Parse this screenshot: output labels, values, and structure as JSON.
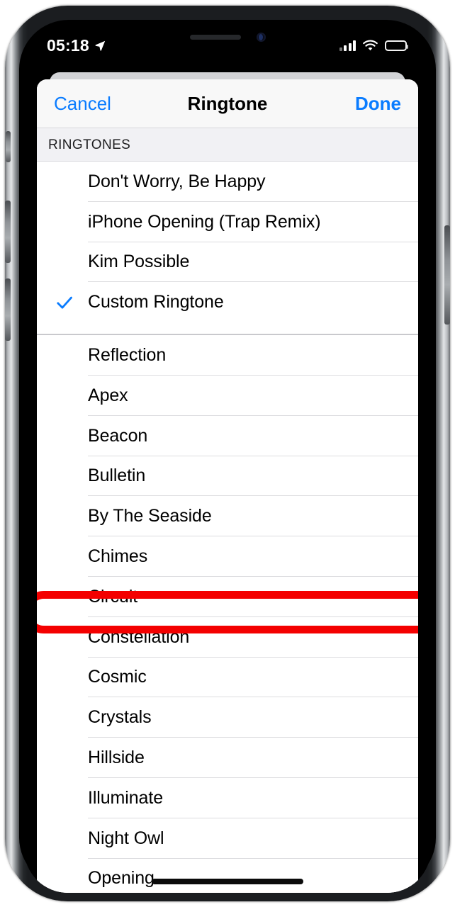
{
  "status_bar": {
    "time": "05:18",
    "location_icon": "location-arrow-icon",
    "signal_icon": "cellular-signal-icon",
    "wifi_icon": "wifi-icon",
    "battery_icon": "battery-full-icon"
  },
  "nav": {
    "cancel_label": "Cancel",
    "title": "Ringtone",
    "done_label": "Done"
  },
  "colors": {
    "accent_blue": "#0a7cff",
    "annotation_red": "#f40000",
    "header_bg": "#f1f1f4"
  },
  "sections": [
    {
      "header": "RINGTONES",
      "items": [
        {
          "label": "Don't Worry, Be Happy",
          "selected": false,
          "highlighted": false
        },
        {
          "label": "iPhone Opening (Trap Remix)",
          "selected": false,
          "highlighted": false
        },
        {
          "label": "Kim Possible",
          "selected": false,
          "highlighted": false
        },
        {
          "label": "Custom Ringtone",
          "selected": true,
          "highlighted": false
        }
      ]
    },
    {
      "header": "",
      "items": [
        {
          "label": "Reflection",
          "selected": false,
          "highlighted": false
        },
        {
          "label": "Apex",
          "selected": false,
          "highlighted": false
        },
        {
          "label": "Beacon",
          "selected": false,
          "highlighted": false
        },
        {
          "label": "Bulletin",
          "selected": false,
          "highlighted": false
        },
        {
          "label": "By The Seaside",
          "selected": false,
          "highlighted": true
        },
        {
          "label": "Chimes",
          "selected": false,
          "highlighted": false
        },
        {
          "label": "Circuit",
          "selected": false,
          "highlighted": false
        },
        {
          "label": "Constellation",
          "selected": false,
          "highlighted": false
        },
        {
          "label": "Cosmic",
          "selected": false,
          "highlighted": false
        },
        {
          "label": "Crystals",
          "selected": false,
          "highlighted": false
        },
        {
          "label": "Hillside",
          "selected": false,
          "highlighted": false
        },
        {
          "label": "Illuminate",
          "selected": false,
          "highlighted": false
        },
        {
          "label": "Night Owl",
          "selected": false,
          "highlighted": false
        },
        {
          "label": "Opening",
          "selected": false,
          "highlighted": false
        }
      ]
    }
  ],
  "annotation": {
    "target_label": "By The Seaside",
    "shape": "oval-outline"
  }
}
